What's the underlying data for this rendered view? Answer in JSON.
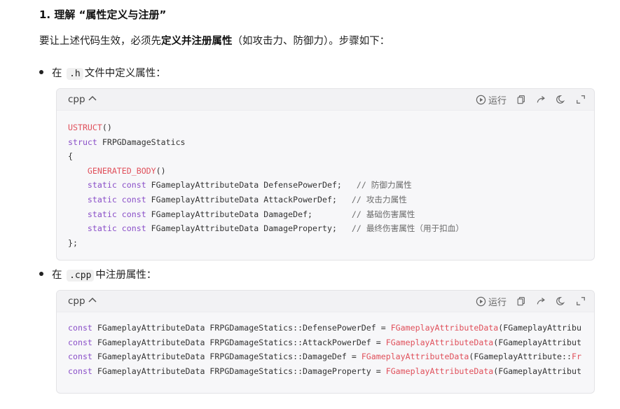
{
  "heading": "1. 理解 “属性定义与注册”",
  "intro": {
    "before": "要让上述代码生效，必须先",
    "bold": "定义并注册属性",
    "after": "（如攻击力、防御力）。步骤如下："
  },
  "bullets": [
    {
      "prefix": "在",
      "code": ".h",
      "suffix": "文件中定义属性："
    },
    {
      "prefix": "在",
      "code": ".cpp",
      "suffix": "中注册属性："
    }
  ],
  "codeblock_toolbar": {
    "language": "cpp",
    "run_label": "运行"
  },
  "code_h": {
    "line1": {
      "macro": "USTRUCT",
      "rest": "()"
    },
    "line2": {
      "kw": "struct",
      "rest": " FRPGDamageStatics"
    },
    "line3": "{",
    "line4": {
      "macro": "GENERATED_BODY",
      "rest": "()"
    },
    "fields": [
      {
        "kw1": "static",
        "kw2": "const",
        "decl": " FGameplayAttributeData DefensePowerDef;",
        "pad": "   ",
        "comment": "// 防御力属性"
      },
      {
        "kw1": "static",
        "kw2": "const",
        "decl": " FGameplayAttributeData AttackPowerDef;",
        "pad": "   ",
        "comment": "// 攻击力属性"
      },
      {
        "kw1": "static",
        "kw2": "const",
        "decl": " FGameplayAttributeData DamageDef;",
        "pad": "        ",
        "comment": "// 基础伤害属性"
      },
      {
        "kw1": "static",
        "kw2": "const",
        "decl": " FGameplayAttributeData DamageProperty;",
        "pad": "   ",
        "comment": "// 最终伤害属性（用于扣血）"
      }
    ],
    "close": "};"
  },
  "code_cpp": {
    "lines": [
      {
        "kw": "const",
        "decl": " FGameplayAttributeData FRPGDamageStatics::DefensePowerDef = ",
        "fn": "FGameplayAttributeData",
        "rest": "(FGameplayAttribu"
      },
      {
        "kw": "const",
        "decl": " FGameplayAttributeData FRPGDamageStatics::AttackPowerDef = ",
        "fn": "FGameplayAttributeData",
        "rest": "(FGameplayAttribut"
      },
      {
        "kw": "const",
        "decl": " FGameplayAttributeData FRPGDamageStatics::DamageDef = ",
        "fn": "FGameplayAttributeData",
        "rest": "(FGameplayAttribute::",
        "fn2": "Fr"
      },
      {
        "kw": "const",
        "decl": " FGameplayAttributeData FRPGDamageStatics::DamageProperty = ",
        "fn": "FGameplayAttributeData",
        "rest": "(FGameplayAttribut"
      }
    ]
  },
  "icons": [
    "play-circle-icon",
    "copy-icon",
    "share-arrow-icon",
    "theme-moon-icon",
    "expand-icon",
    "chevron-up-icon"
  ]
}
